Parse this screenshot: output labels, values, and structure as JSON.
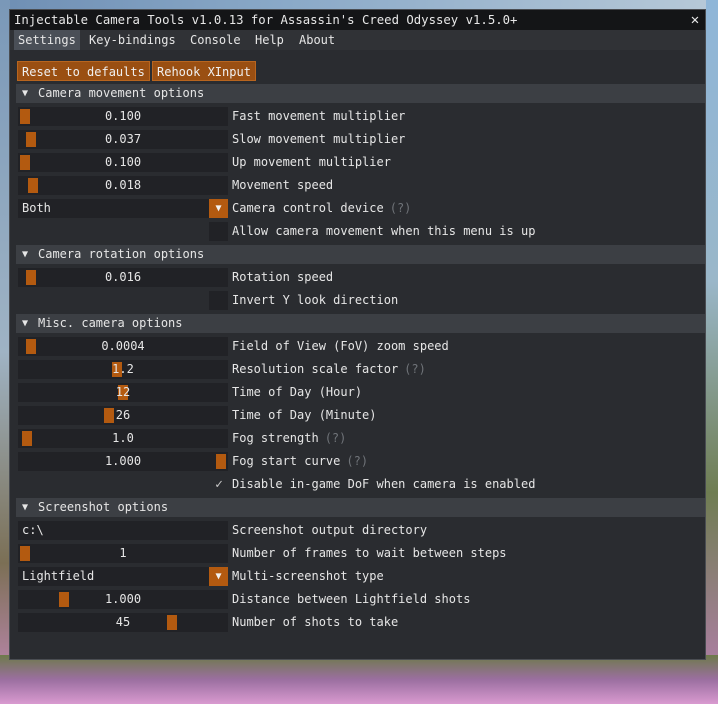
{
  "window": {
    "title": "Injectable Camera Tools v1.0.13 for Assassin's Creed Odyssey v1.5.0+",
    "close_glyph": "✕"
  },
  "menu": [
    "Settings",
    "Key-bindings",
    "Console",
    "Help",
    "About"
  ],
  "buttons": {
    "reset": "Reset to defaults",
    "rehook": "Rehook XInput"
  },
  "icons": {
    "collapse": "▼",
    "combo": "▼",
    "check": "✓"
  },
  "sections": {
    "movement": {
      "title": "Camera movement options",
      "rows": [
        {
          "value": "0.100",
          "label": "Fast movement multiplier",
          "grab": 0.0
        },
        {
          "value": "0.037",
          "label": "Slow movement multiplier",
          "grab": 0.03
        },
        {
          "value": "0.100",
          "label": "Up movement multiplier",
          "grab": 0.0
        },
        {
          "value": "0.018",
          "label": "Movement speed",
          "grab": 0.04
        }
      ],
      "device": {
        "value": "Both",
        "label": "Camera control device",
        "hint": "(?)"
      },
      "allow": {
        "label": "Allow camera movement when this menu is up",
        "checked": false
      }
    },
    "rotation": {
      "title": "Camera rotation options",
      "speed": {
        "value": "0.016",
        "label": "Rotation speed",
        "grab": 0.03
      },
      "invert": {
        "label": "Invert Y look direction",
        "checked": false
      }
    },
    "misc": {
      "title": "Misc. camera options",
      "rows": [
        {
          "value": "0.0004",
          "label": "Field of View (FoV) zoom speed",
          "hint": "",
          "grab": 0.03
        },
        {
          "value": "1.2",
          "label": "Resolution scale factor",
          "hint": "(?)",
          "grab": 0.47
        },
        {
          "value": "12",
          "label": "Time of Day (Hour)",
          "hint": "",
          "grab": 0.5
        },
        {
          "value": "26",
          "label": "Time of Day (Minute)",
          "hint": "",
          "grab": 0.43
        },
        {
          "value": "1.0",
          "label": "Fog strength",
          "hint": "(?)",
          "grab": 0.01
        },
        {
          "value": "1.000",
          "label": "Fog start curve",
          "hint": "(?)",
          "grab": 1.0
        }
      ],
      "dof": {
        "label": "Disable in-game DoF when camera is enabled",
        "checked": true
      }
    },
    "screenshot": {
      "title": "Screenshot options",
      "dir": {
        "value": "c:\\",
        "label": "Screenshot output directory"
      },
      "frames": {
        "value": "1",
        "label": "Number of frames to wait between steps",
        "grab": 0.0
      },
      "type": {
        "value": "Lightfield",
        "label": "Multi-screenshot type"
      },
      "distance": {
        "value": "1.000",
        "label": "Distance between Lightfield shots",
        "grab": 0.2
      },
      "shots": {
        "value": "45",
        "label": "Number of shots to take",
        "grab": 0.75
      }
    }
  }
}
